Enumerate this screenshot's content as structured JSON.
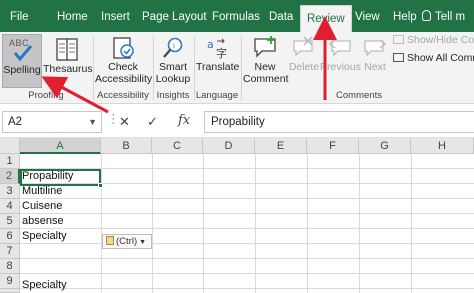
{
  "tabs": [
    {
      "label": "File"
    },
    {
      "label": "Home"
    },
    {
      "label": "Insert"
    },
    {
      "label": "Page Layout"
    },
    {
      "label": "Formulas"
    },
    {
      "label": "Data"
    },
    {
      "label": "Review",
      "active": true
    },
    {
      "label": "View"
    },
    {
      "label": "Help"
    }
  ],
  "tell_me": "Tell m",
  "ribbon": {
    "proofing": {
      "group_label": "Proofing",
      "spelling": {
        "icon_text": "ABC",
        "label": "Spelling",
        "icon": "spell-check-icon"
      },
      "thesaurus": {
        "label": "Thesaurus",
        "icon": "book-icon"
      }
    },
    "accessibility": {
      "group_label": "Accessibility",
      "check": {
        "label_line1": "Check",
        "label_line2": "Accessibility",
        "icon": "check-accessibility-icon"
      }
    },
    "insights": {
      "group_label": "Insights",
      "smart_lookup": {
        "label_line1": "Smart",
        "label_line2": "Lookup",
        "icon": "magnifier-icon"
      }
    },
    "language": {
      "group_label": "Language",
      "translate": {
        "label": "Translate",
        "icon": "translate-icon"
      }
    },
    "comments": {
      "group_label": "Comments",
      "new_comment": {
        "label_line1": "New",
        "label_line2": "Comment",
        "icon": "new-comment-icon"
      },
      "delete": {
        "label": "Delete",
        "icon": "delete-comment-icon",
        "enabled": false
      },
      "previous": {
        "label": "Previous",
        "icon": "previous-comment-icon",
        "enabled": false
      },
      "next": {
        "label": "Next",
        "icon": "next-comment-icon",
        "enabled": false
      },
      "show_hide": {
        "label": "Show/Hide Co",
        "enabled": false
      },
      "show_all": {
        "label": "Show All Comm",
        "enabled": true
      }
    }
  },
  "formula_bar": {
    "name_box": "A2",
    "cancel_symbol": "✕",
    "enter_symbol": "✓",
    "fx": "fx",
    "content": "Propability"
  },
  "grid": {
    "columns": [
      "A",
      "B",
      "C",
      "D",
      "E",
      "F",
      "G",
      "H"
    ],
    "rows": [
      "1",
      "2",
      "3",
      "4",
      "5",
      "6",
      "7",
      "8",
      "9",
      "10"
    ],
    "active_cell": "A2",
    "cells": [
      {
        "row": "2",
        "value": "Propability"
      },
      {
        "row": "3",
        "value": "Multiline"
      },
      {
        "row": "4",
        "value": "Cuisene"
      },
      {
        "row": "5",
        "value": "absense"
      },
      {
        "row": "6",
        "value": "Specialty"
      },
      {
        "row": "10",
        "value": "Specialty"
      }
    ]
  },
  "paste_options": {
    "label": "(Ctrl)",
    "icon": "clipboard-icon"
  },
  "colors": {
    "excel_green": "#217346",
    "annotation_arrow": "#e0202e"
  }
}
